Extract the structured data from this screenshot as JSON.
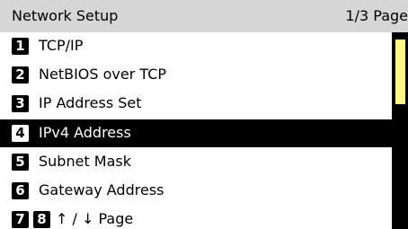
{
  "header": {
    "title": "Network Setup",
    "page_indicator": "1/3 Page"
  },
  "menu": {
    "selected_index": 3,
    "items": [
      {
        "number": "1",
        "label": "TCP/IP"
      },
      {
        "number": "2",
        "label": "NetBIOS over TCP"
      },
      {
        "number": "3",
        "label": "IP Address Set"
      },
      {
        "number": "4",
        "label": "IPv4 Address"
      },
      {
        "number": "5",
        "label": "Subnet Mask"
      },
      {
        "number": "6",
        "label": "Gateway Address"
      }
    ],
    "page_nav": {
      "prev_number": "7",
      "next_number": "8",
      "label": "↑ / ↓ Page"
    }
  },
  "colors": {
    "header_bg": "#d6d6d6",
    "selected_bg": "#000000",
    "scroll_thumb": "#fff58a"
  }
}
